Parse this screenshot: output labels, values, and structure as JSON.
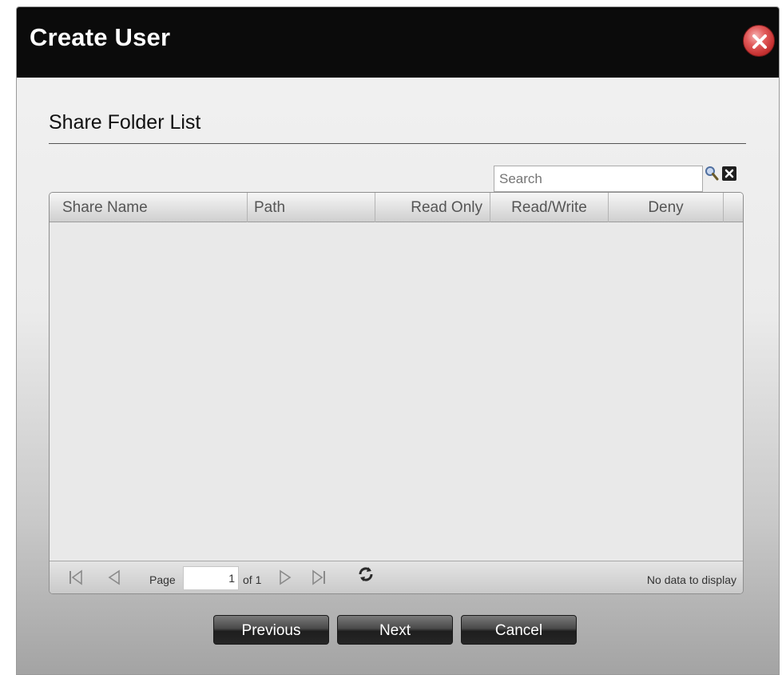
{
  "dialog": {
    "title": "Create User",
    "section_title": "Share Folder List",
    "close_icon": "close-icon"
  },
  "search": {
    "placeholder": "Search",
    "value": ""
  },
  "grid": {
    "columns": [
      "Share Name",
      "Path",
      "Read Only",
      "Read/Write",
      "Deny"
    ],
    "rows": []
  },
  "pager": {
    "page_label": "Page",
    "page_value": "1",
    "of_label": "of 1",
    "status": "No data to display",
    "icons": [
      "first-page-icon",
      "prev-page-icon",
      "next-page-icon",
      "last-page-icon",
      "refresh-icon"
    ]
  },
  "buttons": {
    "previous": "Previous",
    "next": "Next",
    "cancel": "Cancel"
  },
  "colors": {
    "titlebar": "#0b0b0b",
    "close": "#c43030",
    "button": "#262626"
  }
}
